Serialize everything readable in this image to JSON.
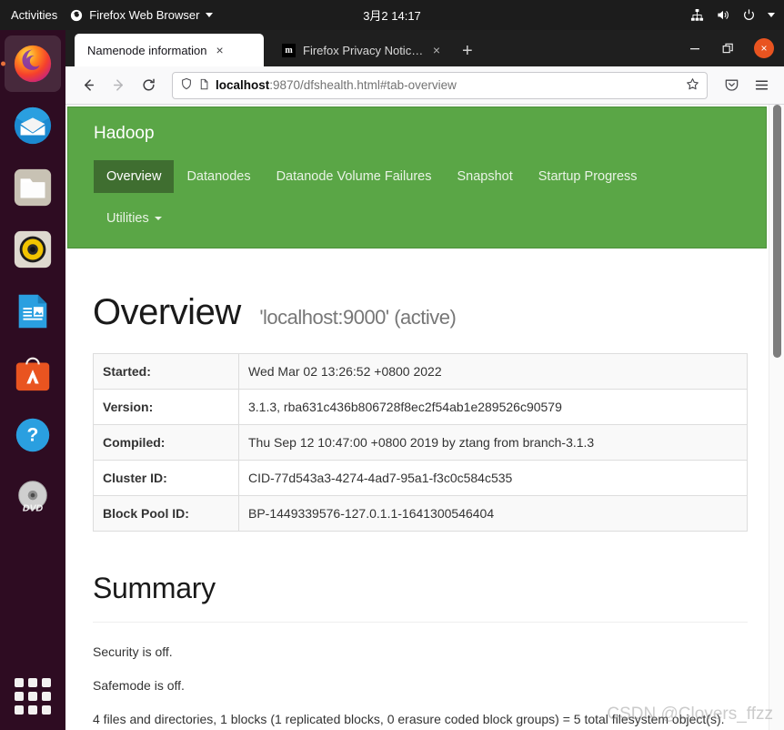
{
  "desktop": {
    "activities_label": "Activities",
    "app_menu_label": "Firefox Web Browser",
    "clock": "3月2 14:17",
    "sys_icons": [
      "network-icon",
      "volume-icon",
      "power-icon",
      "chevron-down-icon"
    ]
  },
  "dock": {
    "items": [
      {
        "name": "firefox",
        "label": "Firefox Web Browser",
        "active": true
      },
      {
        "name": "thunderbird",
        "label": "Thunderbird Mail",
        "active": false
      },
      {
        "name": "files",
        "label": "Files",
        "active": false
      },
      {
        "name": "rhythmbox",
        "label": "Rhythmbox",
        "active": false
      },
      {
        "name": "libreoffice-writer",
        "label": "LibreOffice Writer",
        "active": false
      },
      {
        "name": "ubuntu-software",
        "label": "Ubuntu Software",
        "active": false
      },
      {
        "name": "help",
        "label": "Help",
        "active": false
      },
      {
        "name": "dvd",
        "label": "DVD",
        "active": false
      }
    ],
    "show_apps_label": "Show Applications"
  },
  "browser": {
    "tabs": [
      {
        "title": "Namenode information",
        "active": true,
        "favicon": "none",
        "close_label": "×"
      },
      {
        "title": "Firefox Privacy Notice — ",
        "active": false,
        "favicon": "m",
        "close_label": "×"
      }
    ],
    "new_tab_label": "+",
    "window_controls": {
      "minimize": "—",
      "restore": "restore-icon",
      "close": "×"
    },
    "nav": {
      "back": "back-icon",
      "forward": "forward-icon",
      "reload": "reload-icon",
      "shield": "shield-icon",
      "page_icon": "page-icon",
      "url_host": "localhost",
      "url_rest": ":9870/dfshealth.html#tab-overview",
      "url_full": "localhost:9870/dfshealth.html#tab-overview",
      "bookmark": "star-icon",
      "pocket": "pocket-icon",
      "menu": "hamburger-menu-icon"
    }
  },
  "hadoop": {
    "brand": "Hadoop",
    "nav_color": "#5aa646",
    "nav_active_color": "#3f6e30",
    "tabs": [
      {
        "label": "Overview",
        "active": true
      },
      {
        "label": "Datanodes",
        "active": false
      },
      {
        "label": "Datanode Volume Failures",
        "active": false
      },
      {
        "label": "Snapshot",
        "active": false
      },
      {
        "label": "Startup Progress",
        "active": false
      }
    ],
    "utilities_label": "Utilities"
  },
  "overview": {
    "heading": "Overview",
    "subheading": "'localhost:9000' (active)",
    "rows": [
      {
        "label": "Started:",
        "value": "Wed Mar 02 13:26:52 +0800 2022"
      },
      {
        "label": "Version:",
        "value": "3.1.3, rba631c436b806728f8ec2f54ab1e289526c90579"
      },
      {
        "label": "Compiled:",
        "value": "Thu Sep 12 10:47:00 +0800 2019 by ztang from branch-3.1.3"
      },
      {
        "label": "Cluster ID:",
        "value": "CID-77d543a3-4274-4ad7-95a1-f3c0c584c535"
      },
      {
        "label": "Block Pool ID:",
        "value": "BP-1449339576-127.0.1.1-1641300546404"
      }
    ]
  },
  "summary": {
    "heading": "Summary",
    "lines": [
      "Security is off.",
      "Safemode is off.",
      "4 files and directories, 1 blocks (1 replicated blocks, 0 erasure coded block groups) = 5 total filesystem object(s)."
    ]
  },
  "watermark": "CSDN @Clovers_ffzz"
}
